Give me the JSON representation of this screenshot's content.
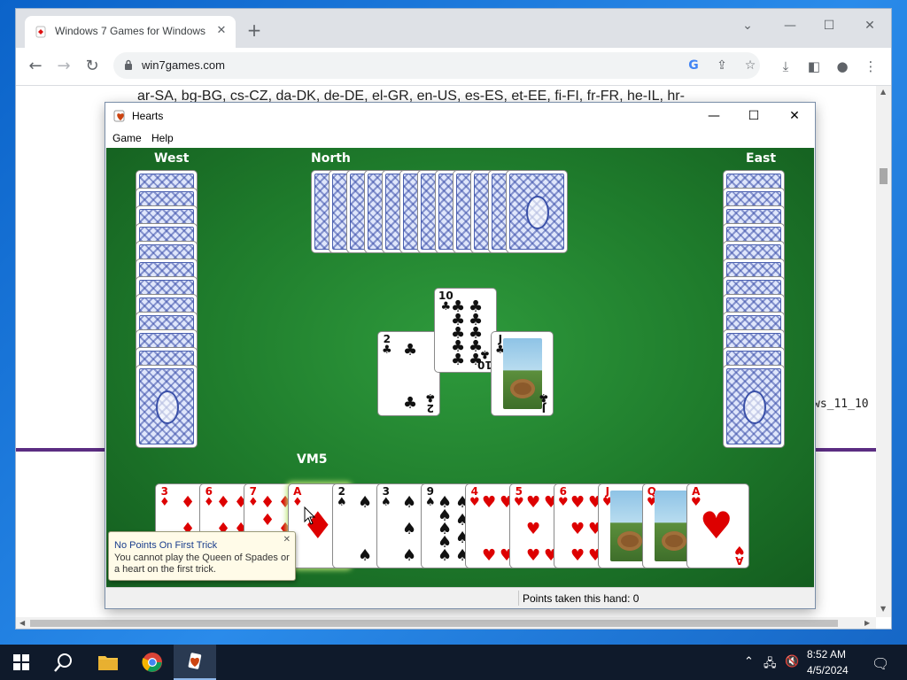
{
  "browser": {
    "tab_title": "Windows 7 Games for Windows",
    "url": "win7games.com",
    "page_langs": "ar-SA, bg-BG, cs-CZ, da-DK, de-DE, el-GR, en-US, es-ES, et-EE, fi-FI, fr-FR, he-IL, hr-",
    "page_code": "ws_11_10"
  },
  "hearts": {
    "title": "Hearts",
    "menu": [
      "Game",
      "Help"
    ],
    "players": {
      "west": "West",
      "north": "North",
      "east": "East",
      "south": "VM5"
    },
    "trick": [
      {
        "rank": "2",
        "suit": "♣",
        "color": "blk"
      },
      {
        "rank": "10",
        "suit": "♣",
        "color": "blk"
      },
      {
        "rank": "J",
        "suit": "♣",
        "color": "blk"
      }
    ],
    "hand": [
      {
        "rank": "3",
        "suit": "♦",
        "color": "red"
      },
      {
        "rank": "6",
        "suit": "♦",
        "color": "red"
      },
      {
        "rank": "7",
        "suit": "♦",
        "color": "red"
      },
      {
        "rank": "A",
        "suit": "♦",
        "color": "red"
      },
      {
        "rank": "2",
        "suit": "♠",
        "color": "blk"
      },
      {
        "rank": "3",
        "suit": "♠",
        "color": "blk"
      },
      {
        "rank": "9",
        "suit": "♠",
        "color": "blk"
      },
      {
        "rank": "4",
        "suit": "♥",
        "color": "red"
      },
      {
        "rank": "5",
        "suit": "♥",
        "color": "red"
      },
      {
        "rank": "6",
        "suit": "♥",
        "color": "red"
      },
      {
        "rank": "J",
        "suit": "♥",
        "color": "red"
      },
      {
        "rank": "Q",
        "suit": "♥",
        "color": "red"
      },
      {
        "rank": "A",
        "suit": "♥",
        "color": "red"
      }
    ],
    "tooltip": {
      "title": "No Points On First Trick",
      "body": "You cannot play the Queen of Spades or a heart on the first trick."
    },
    "status": "Points taken this hand: 0"
  },
  "taskbar": {
    "time": "8:52 AM",
    "date": "4/5/2024"
  },
  "colors": {
    "felt": "#1e7a2b",
    "taskbar": "#0f1a2b",
    "accent": "#5b2d82"
  }
}
